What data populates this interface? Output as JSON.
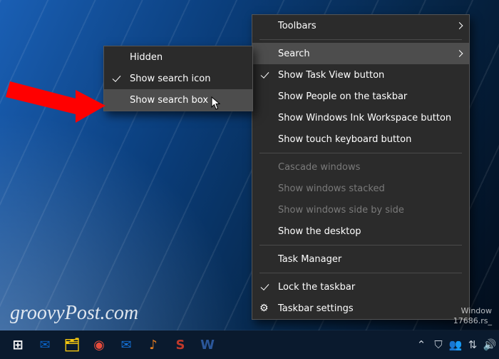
{
  "main_menu": {
    "toolbars": "Toolbars",
    "search": "Search",
    "show_task_view": "Show Task View button",
    "show_people": "Show People on the taskbar",
    "show_ink": "Show Windows Ink Workspace button",
    "show_touch_kb": "Show touch keyboard button",
    "cascade": "Cascade windows",
    "stacked": "Show windows stacked",
    "side_by_side": "Show windows side by side",
    "show_desktop": "Show the desktop",
    "task_manager": "Task Manager",
    "lock_taskbar": "Lock the taskbar",
    "taskbar_settings": "Taskbar settings"
  },
  "search_submenu": {
    "hidden": "Hidden",
    "show_icon": "Show search icon",
    "show_box": "Show search box"
  },
  "watermark": "groovyPost.com",
  "build_info": {
    "line1": "Window",
    "line2": "17686.rs_"
  },
  "taskbar_icons": [
    {
      "name": "start",
      "glyph": "⊞",
      "color": "#ffffff"
    },
    {
      "name": "outlook",
      "glyph": "✉",
      "color": "#0a62c4"
    },
    {
      "name": "file-explorer",
      "glyph": "🗂",
      "color": "#f1c40f"
    },
    {
      "name": "chrome",
      "glyph": "◉",
      "color": "#e74c3c"
    },
    {
      "name": "mail",
      "glyph": "✉",
      "color": "#1470d6"
    },
    {
      "name": "groove",
      "glyph": "♪",
      "color": "#e67e22"
    },
    {
      "name": "snagit",
      "glyph": "S",
      "color": "#c0392b"
    },
    {
      "name": "word",
      "glyph": "W",
      "color": "#2b579a"
    }
  ],
  "tray_icons": [
    "chevron-up",
    "security",
    "people",
    "network",
    "volume"
  ]
}
